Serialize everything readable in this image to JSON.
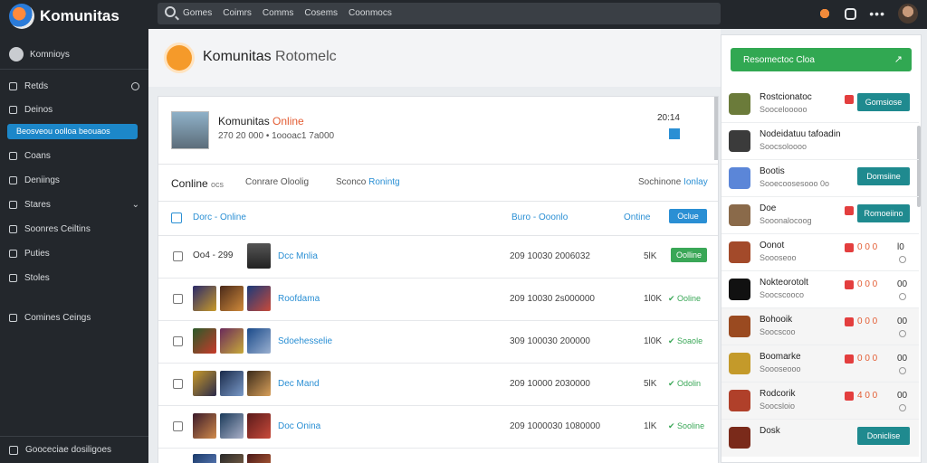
{
  "app": {
    "name": "Komunitas"
  },
  "topbar": {
    "search_links": [
      "Gomes",
      "Coimrs",
      "Comms",
      "Cosems",
      "Coonmocs"
    ]
  },
  "sidebar": {
    "user": "Komnioys",
    "items": [
      {
        "label": "Retds",
        "icon": "home-icon"
      },
      {
        "label": "Deinos",
        "icon": "list-icon"
      },
      {
        "label": "Coans",
        "icon": "user-icon"
      },
      {
        "label": "Deniings",
        "icon": "settings-icon"
      },
      {
        "label": "Stares",
        "icon": "star-icon"
      },
      {
        "label": "Soonres Ceiltins",
        "icon": "grid-icon"
      },
      {
        "label": "Puties",
        "icon": "chart-icon"
      },
      {
        "label": "Stoles",
        "icon": "table-icon"
      },
      {
        "label": "Comines Ceings",
        "icon": "chat-icon"
      }
    ],
    "active_item": "Beosveou oolloa beouaos",
    "bottom": "Gooceciae dosiligoes"
  },
  "header": {
    "title": "Komunitas",
    "subtitle": "Rotomelc"
  },
  "profile": {
    "name": "Komunitas",
    "status": "Online",
    "meta": "270 20 000  •  1oooac1 7a000",
    "right_value": "20:14"
  },
  "tabs": [
    {
      "label": "Conline",
      "extra": "ocs"
    },
    {
      "label": "Conrare",
      "extra": "Oloolig"
    },
    {
      "label": "Sconco",
      "extra": "Ronintg"
    },
    {
      "label": "Sochinone",
      "extra": "Ionlay"
    }
  ],
  "filter": {
    "label": "Dorc - Online",
    "mid": "Buro - Ooonlo",
    "right": "Ontine",
    "button": "Oclue"
  },
  "rows": [
    {
      "id": "Oo4 - 299",
      "name": "Dcc Mnlia",
      "number": "209 10030 2006032",
      "count": "5lK",
      "status": "Oolline",
      "has_button": true
    },
    {
      "id": "",
      "name": "Roofdama",
      "number": "209 10030 2s000000",
      "count": "1l0K",
      "status": "Ooline"
    },
    {
      "id": "",
      "name": "Sdoehesselie",
      "number": "309 100030 200000",
      "count": "1l0K",
      "status": "Soaole"
    },
    {
      "id": "",
      "name": "Dec Mand",
      "number": "209 10000 2030000",
      "count": "5lK",
      "status": "Odolin"
    },
    {
      "id": "",
      "name": "Doc Onina",
      "number": "209 1000030 1080000",
      "count": "1lK",
      "status": "Sooline"
    }
  ],
  "right_panel": {
    "button": "Resomectoc Cloa",
    "items": [
      {
        "title": "Rostcionatoc",
        "sub": "Soocelooooo",
        "action": "Gomsiose",
        "avatar": "#6b7b3a"
      },
      {
        "title": "Nodeidatuu tafoadin",
        "sub": "Soocsoloooo",
        "avatar": "#3b3b3b"
      },
      {
        "title": "Bootis",
        "sub": "Sooecoosesooo  0o",
        "action": "Domsiine",
        "avatar": "#5b86d8"
      },
      {
        "title": "Doe",
        "sub": "Sooonalocoog",
        "action": "Romoeiino",
        "avatar": "#8a6a4a"
      },
      {
        "title": "Oonot",
        "sub": "Soooseoo",
        "nums": "0 0 0",
        "count": "l0",
        "avatar": "#a34a2a"
      },
      {
        "title": "Nokteorotolt",
        "sub": "Soocscooco",
        "nums": "0 0 0",
        "count": "00",
        "avatar": "#111111"
      },
      {
        "title": "Bohooik",
        "sub": "Soocscoo",
        "nums": "0 0 0",
        "count": "00",
        "avatar": "#9a4a20"
      },
      {
        "title": "Boomarke",
        "sub": "Soooseooo",
        "nums": "0 0 0",
        "count": "00",
        "avatar": "#c49a2a"
      },
      {
        "title": "Rodcorik",
        "sub": "Soocsloio",
        "nums": "4 0 0",
        "count": "00",
        "avatar": "#b0402a"
      },
      {
        "title": "Dosk",
        "sub": "",
        "action": "Doniclise",
        "avatar": "#7a2a1a"
      }
    ]
  },
  "colors": {
    "accent": "#2a8fd4",
    "green": "#3aa757",
    "teal": "#1f8a8f",
    "orange": "#e35d34"
  }
}
